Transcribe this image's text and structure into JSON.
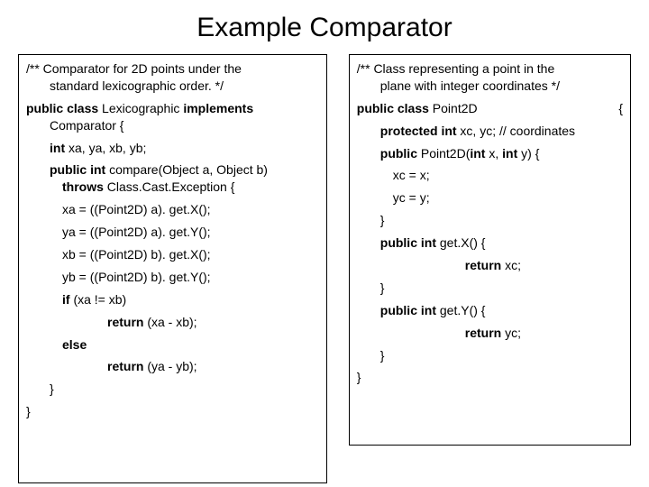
{
  "title": "Example Comparator",
  "left": {
    "c1a": "/** Comparator for 2D points under the",
    "c1b": "standard lexicographic order. */",
    "l1a": "public class",
    "l1b": " Lexicographic ",
    "l1c": "implements",
    "l1d": "Comparator {",
    "l2a": "int",
    "l2b": " xa, ya, xb, yb;",
    "l3a": "public int",
    "l3b": " compare(Object a, Object b) ",
    "l3c": "throws",
    "l3d": " Class.Cast.Exception {",
    "l4": "xa = ((Point2D) a). get.X();",
    "l5": "ya = ((Point2D) a). get.Y();",
    "l6": "xb = ((Point2D) b). get.X();",
    "l7": "yb = ((Point2D) b). get.Y();",
    "l8a": "if",
    "l8b": " (xa != xb)",
    "l9a": "return",
    "l9b": " (xa - xb);",
    "l10": "else",
    "l11a": "return",
    "l11b": " (ya - yb);",
    "l12": "}",
    "l13": "}"
  },
  "right": {
    "c1a": "/** Class representing a point in the",
    "c1b": "plane with integer coordinates */",
    "r1a": "public class",
    "r1b": " Point2D",
    "r1c": "{",
    "r2a": "protected int",
    "r2b": " xc, yc; // coordinates",
    "r3a": "public",
    "r3b": " Point2D(",
    "r3c": "int",
    "r3d": " x, ",
    "r3e": "int",
    "r3f": " y) {",
    "r4": "xc = x;",
    "r5": "yc = y;",
    "r6": "}",
    "r7a": "public int",
    "r7b": " get.X() {",
    "r8a": "return",
    "r8b": " xc;",
    "r9": "}",
    "r10a": "public int",
    "r10b": " get.Y() {",
    "r11a": "return",
    "r11b": " yc;",
    "r12": "}",
    "r13": "}"
  }
}
